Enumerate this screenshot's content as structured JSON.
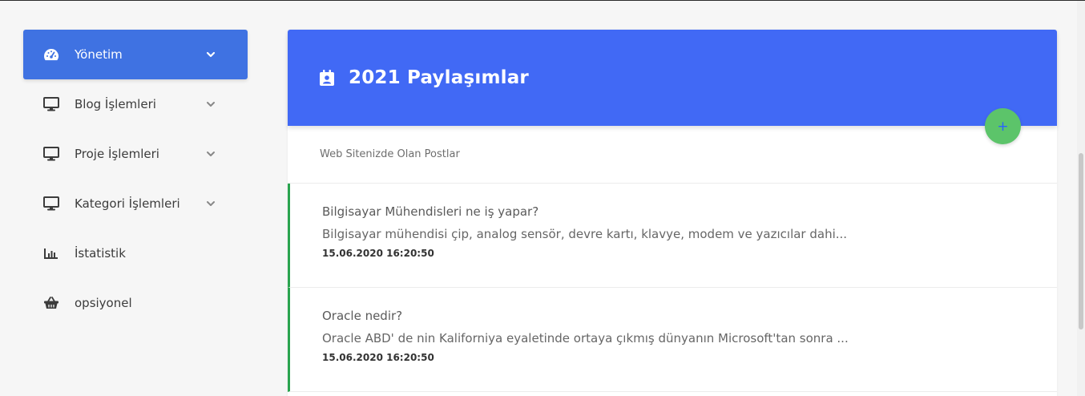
{
  "sidebar": {
    "items": [
      {
        "label": "Yönetim",
        "icon": "dashboard-icon",
        "active": true,
        "has_chevron": true
      },
      {
        "label": "Blog İşlemleri",
        "icon": "monitor-icon",
        "active": false,
        "has_chevron": true
      },
      {
        "label": "Proje İşlemleri",
        "icon": "monitor-icon",
        "active": false,
        "has_chevron": true
      },
      {
        "label": "Kategori İşlemleri",
        "icon": "monitor-icon",
        "active": false,
        "has_chevron": true
      },
      {
        "label": "İstatistik",
        "icon": "bar-chart-icon",
        "active": false,
        "has_chevron": false
      },
      {
        "label": "opsiyonel",
        "icon": "basket-icon",
        "active": false,
        "has_chevron": false
      }
    ]
  },
  "card": {
    "title": "2021 Paylaşımlar",
    "title_icon": "calendar-user-icon",
    "add_label": "+",
    "subtitle": "Web Sitenizde Olan Postlar",
    "posts": [
      {
        "title": "Bilgisayar Mühendisleri ne iş yapar?",
        "excerpt": "Bilgisayar mühendisi çip, analog sensör, devre kartı, klavye, modem ve yazıcılar dahi...",
        "date": "15.06.2020 16:20:50"
      },
      {
        "title": "Oracle nedir?",
        "excerpt": "Oracle ABD' de nin Kaliforniya eyaletinde ortaya çıkmış dünyanın Microsoft'tan sonra ...",
        "date": "15.06.2020 16:20:50"
      }
    ]
  },
  "colors": {
    "accent": "#4169f5",
    "active_nav": "#3f72e2",
    "fab": "#5cc46a",
    "post_border": "#2aa44f"
  }
}
